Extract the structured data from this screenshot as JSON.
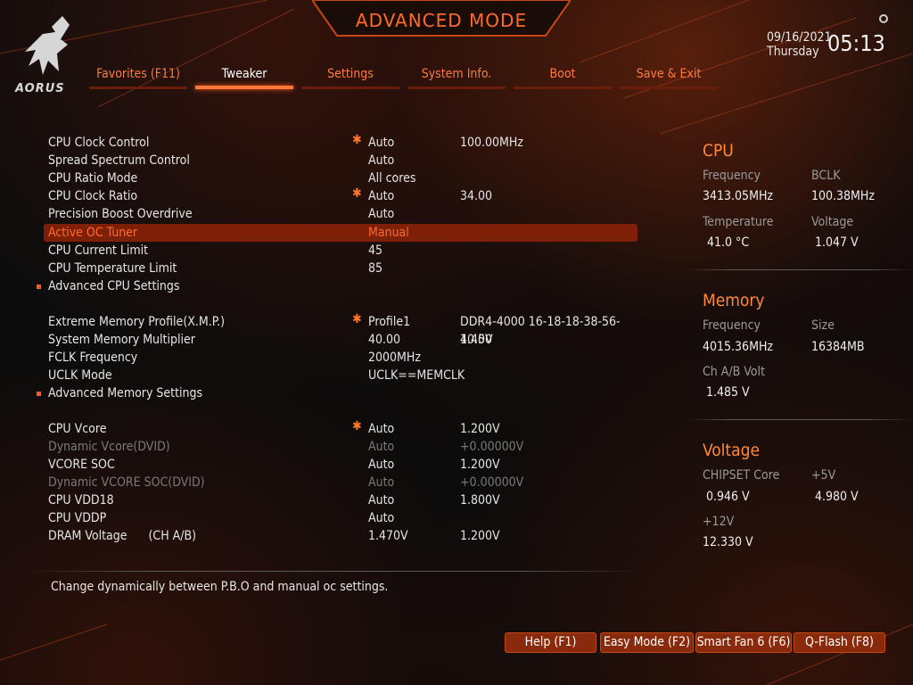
{
  "header": {
    "title": "ADVANCED MODE",
    "logo_text": "AORUS",
    "date": "09/16/2021",
    "day": "Thursday",
    "time": "05:13"
  },
  "tabs": [
    {
      "label": "Favorites (F11)",
      "active": false
    },
    {
      "label": "Tweaker",
      "active": true
    },
    {
      "label": "Settings",
      "active": false
    },
    {
      "label": "System Info.",
      "active": false
    },
    {
      "label": "Boot",
      "active": false
    },
    {
      "label": "Save & Exit",
      "active": false
    }
  ],
  "settings": [
    {
      "label": "CPU Clock Control",
      "star": true,
      "value": "Auto",
      "current": "100.00MHz"
    },
    {
      "label": "Spread Spectrum Control",
      "value": "Auto"
    },
    {
      "label": "CPU Ratio Mode",
      "value": "All cores"
    },
    {
      "label": "CPU Clock Ratio",
      "star": true,
      "value": "Auto",
      "current": "34.00"
    },
    {
      "label": "Precision Boost Overdrive",
      "value": "Auto"
    },
    {
      "label": "Active OC Tuner",
      "value": "Manual",
      "selected": true
    },
    {
      "label": "CPU Current Limit",
      "value": "45"
    },
    {
      "label": "CPU Temperature Limit",
      "value": "85"
    },
    {
      "label": "Advanced CPU Settings",
      "submenu": true
    },
    {
      "label": "Extreme Memory Profile(X.M.P.)",
      "star": true,
      "value": "Profile1",
      "current": "DDR4-4000 16-18-18-38-56-1.45V"
    },
    {
      "label": "System Memory Multiplier",
      "value": "40.00",
      "current": "40.00"
    },
    {
      "label": "FCLK Frequency",
      "value": "2000MHz"
    },
    {
      "label": "UCLK Mode",
      "value": "UCLK==MEMCLK"
    },
    {
      "label": "Advanced Memory Settings",
      "submenu": true
    },
    {
      "label": "CPU Vcore",
      "star": true,
      "value": "Auto",
      "current": "1.200V"
    },
    {
      "label": "Dynamic Vcore(DVID)",
      "value": "Auto",
      "current": "+0.00000V",
      "disabled": true
    },
    {
      "label": "VCORE SOC",
      "value": "Auto",
      "current": "1.200V"
    },
    {
      "label": "Dynamic VCORE SOC(DVID)",
      "value": "Auto",
      "current": "+0.00000V",
      "disabled": true
    },
    {
      "label": "CPU VDD18",
      "value": "Auto",
      "current": "1.800V"
    },
    {
      "label": "CPU VDDP",
      "value": "Auto"
    },
    {
      "label": "DRAM Voltage      (CH A/B)",
      "value": "1.470V",
      "current": "1.200V"
    }
  ],
  "help_text": "Change dynamically between P.B.O and manual oc settings.",
  "monitor": {
    "cpu": {
      "title": "CPU",
      "frequency_label": "Frequency",
      "frequency": "3413.05MHz",
      "bclk_label": "BCLK",
      "bclk": "100.38MHz",
      "temperature_label": "Temperature",
      "temperature": "41.0 °C",
      "voltage_label": "Voltage",
      "voltage": "1.047 V"
    },
    "memory": {
      "title": "Memory",
      "frequency_label": "Frequency",
      "frequency": "4015.36MHz",
      "size_label": "Size",
      "size": "16384MB",
      "volt_label": "Ch A/B Volt",
      "volt": "1.485 V"
    },
    "voltage": {
      "title": "Voltage",
      "chipset_label": "CHIPSET Core",
      "chipset": "0.946 V",
      "p5v_label": "+5V",
      "p5v": "4.980 V",
      "p12v_label": "+12V",
      "p12v": "12.330 V"
    }
  },
  "buttons": {
    "help": "Help (F1)",
    "easy": "Easy Mode (F2)",
    "fan": "Smart Fan 6 (F6)",
    "qflash": "Q-Flash (F8)"
  },
  "colors": {
    "accent": "#ff7a3a",
    "selected_row": "#7e1f08",
    "button": "#8a2a0c"
  }
}
